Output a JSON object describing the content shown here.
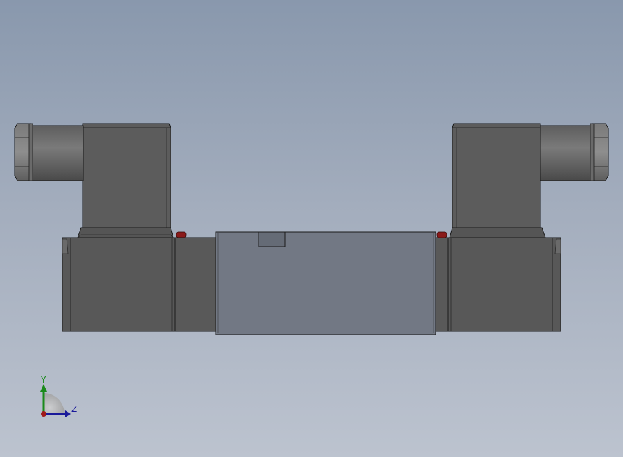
{
  "viewport": {
    "background_top": "#8998ad",
    "background_bottom": "#bcc3cf"
  },
  "model": {
    "name": "",
    "body_color": "#5a5a5a",
    "center_body_color": "#727884",
    "connector_color": "#707070",
    "indicator_color": "#8a1a1a"
  },
  "triad": {
    "y_label": "Y",
    "z_label": "Z",
    "y_color": "#1a8a1a",
    "z_color": "#1a1a9a",
    "x_color": "#a01a1a"
  }
}
